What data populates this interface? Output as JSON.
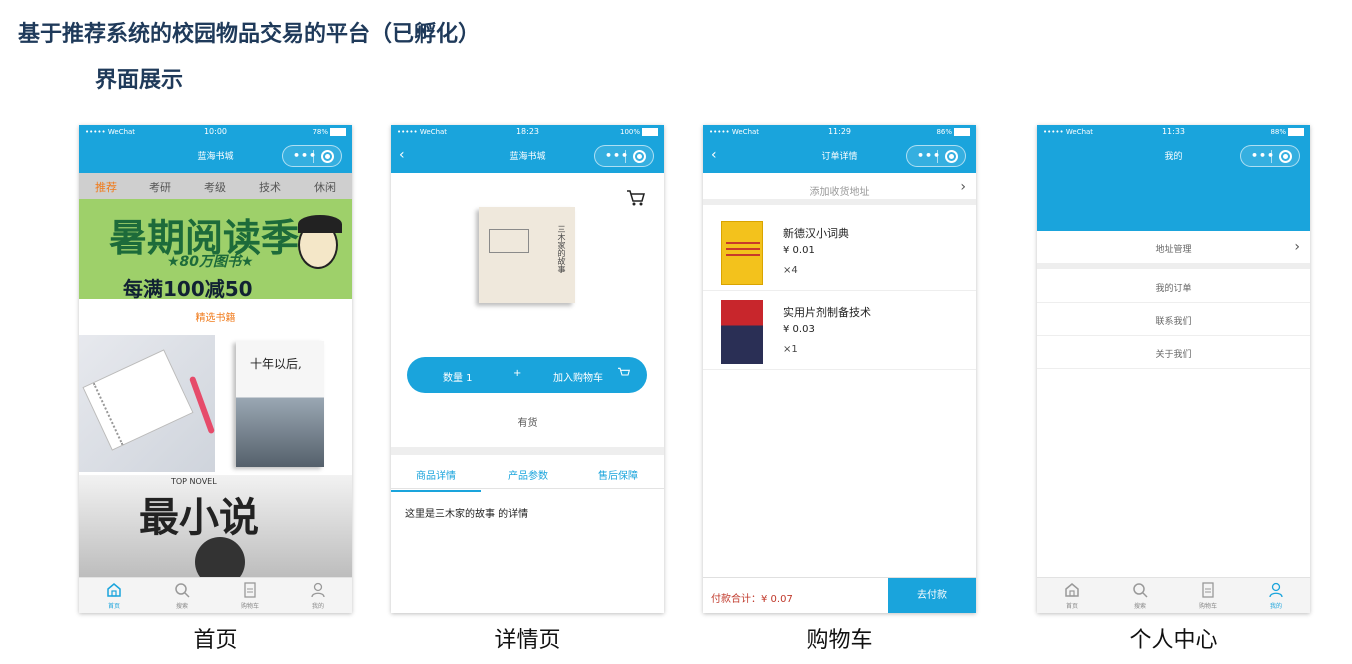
{
  "doc": {
    "title": "基于推荐系统的校园物品交易的平台（已孵化）",
    "subtitle": "界面展示"
  },
  "status": {
    "carrier": "••••• WeChat"
  },
  "screens": {
    "home": {
      "caption": "首页",
      "status_time": "10:00",
      "status_battery": "78%",
      "nav_title": "蓝海书城",
      "categories": [
        "推荐",
        "考研",
        "考级",
        "技术",
        "休闲"
      ],
      "banner": {
        "title": "暑期阅读季",
        "line2": "★80万图书★",
        "line3": "每满100减50"
      },
      "section_title": "精选书籍",
      "book_cover_title": "十年以后,",
      "novel_small": "TOP NOVEL",
      "novel_title": "最小说",
      "tabs": [
        "首页",
        "搜索",
        "购物车",
        "我的"
      ]
    },
    "detail": {
      "caption": "详情页",
      "status_time": "18:23",
      "status_battery": "100%",
      "nav_title": "蓝海书城",
      "book_title": "三木家的故事",
      "qty_label": "数量 1",
      "plus": "+",
      "add_to_cart": "加入购物车",
      "stock": "有货",
      "tabs": [
        "商品详情",
        "产品参数",
        "售后保障"
      ],
      "detail_text": "这里是三木家的故事 的详情"
    },
    "cart": {
      "caption": "购物车",
      "status_time": "11:29",
      "status_battery": "86%",
      "nav_title": "订单详情",
      "address_placeholder": "添加收货地址",
      "items": [
        {
          "name": "新德汉小词典",
          "price": "¥ 0.01",
          "count": "×4"
        },
        {
          "name": "实用片剂制备技术",
          "price": "¥ 0.03",
          "count": "×1"
        }
      ],
      "total_label": "付款合计：¥ 0.07",
      "pay_button": "去付款"
    },
    "profile": {
      "caption": "个人中心",
      "status_time": "11:33",
      "status_battery": "88%",
      "nav_title": "我的",
      "menu": [
        "地址管理",
        "我的订单",
        "联系我们",
        "关于我们"
      ],
      "tabs": [
        "首页",
        "搜索",
        "购物车",
        "我的"
      ]
    }
  },
  "colors": {
    "brand_blue": "#1aa4dc",
    "accent_orange": "#f07a1a",
    "title_navy": "#1f3a5a"
  }
}
